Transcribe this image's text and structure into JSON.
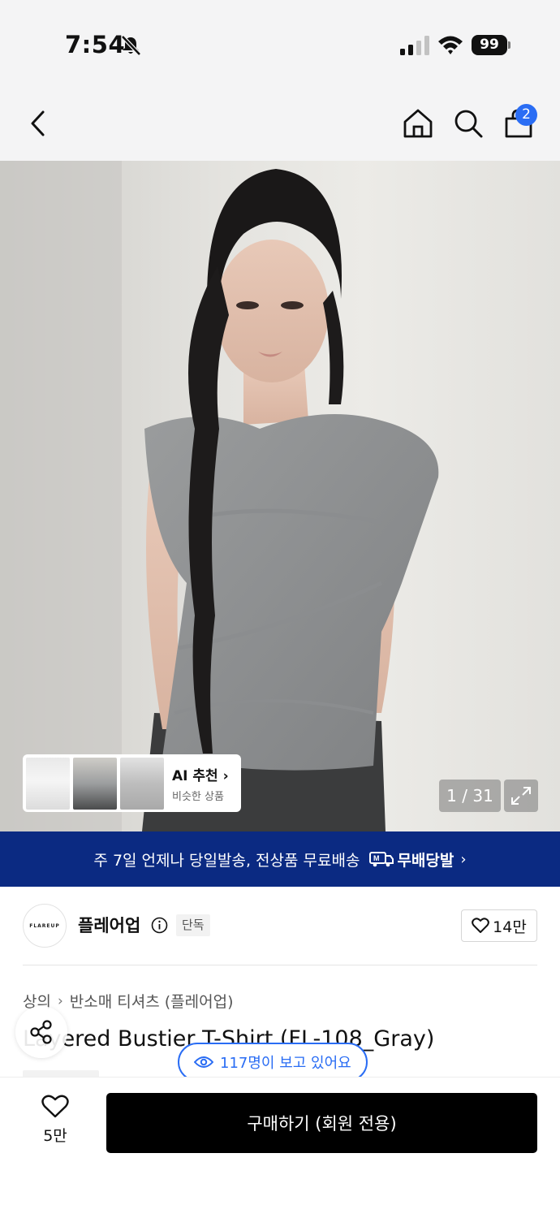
{
  "status_bar": {
    "time": "7:54",
    "battery": "99"
  },
  "header": {
    "cart_count": "2"
  },
  "hero": {
    "ai_recommend": {
      "title": "AI 추천",
      "subtitle": "비슷한 상품"
    },
    "image_counter": "1 / 31"
  },
  "banner": {
    "text": "주 7일 언제나 당일발송, 전상품 무료배송",
    "logo_text": "무배당발"
  },
  "brand": {
    "logo_text": "FLAREUP",
    "name": "플레어업",
    "badge": "단독",
    "likes": "14만"
  },
  "breadcrumb": [
    "상의",
    "반소매 티셔츠 (플레어업)"
  ],
  "product": {
    "title": "Layered Bustier T-Shirt (FL-108_Gray)"
  },
  "viewers": "117명이 보고 있어요",
  "bottom_bar": {
    "likes": "5만",
    "buy_label": "구매하기 (회원 전용)"
  },
  "icons": [
    "bell-off-icon",
    "signal-icon",
    "wifi-icon",
    "back-icon",
    "home-icon",
    "search-icon",
    "cart-icon",
    "chevron-right-icon",
    "expand-icon",
    "delivery-icon",
    "info-icon",
    "heart-icon",
    "share-icon",
    "eye-icon"
  ],
  "colors": {
    "accent_blue": "#2a6df4",
    "banner_navy": "#0b2a82",
    "buy_button": "#000000"
  }
}
